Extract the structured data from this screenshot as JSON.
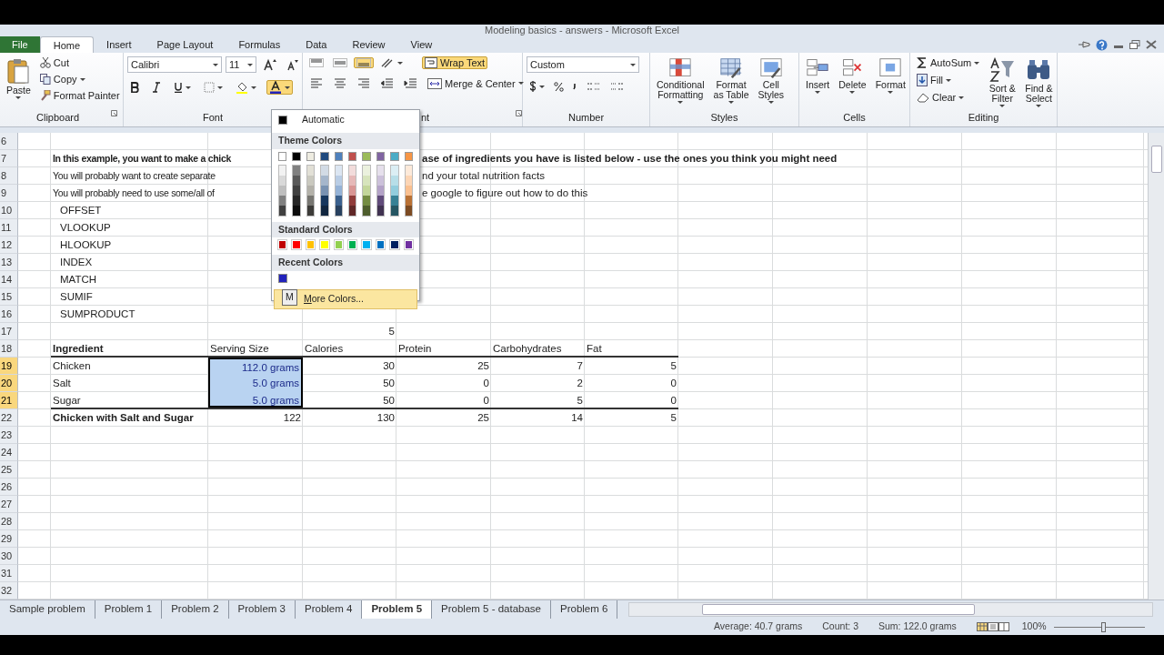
{
  "window": {
    "title": "Modeling basics - answers - Microsoft Excel"
  },
  "ribbon_tabs": [
    {
      "label": "File",
      "kind": "file",
      "selected": false
    },
    {
      "label": "Home",
      "kind": "tab",
      "selected": true
    },
    {
      "label": "Insert",
      "kind": "tab",
      "selected": false
    },
    {
      "label": "Page Layout",
      "kind": "tab",
      "selected": false
    },
    {
      "label": "Formulas",
      "kind": "tab",
      "selected": false
    },
    {
      "label": "Data",
      "kind": "tab",
      "selected": false
    },
    {
      "label": "Review",
      "kind": "tab",
      "selected": false
    },
    {
      "label": "View",
      "kind": "tab",
      "selected": false
    }
  ],
  "clipboard": {
    "label": "Clipboard",
    "paste": "Paste",
    "cut": "Cut",
    "copy": "Copy",
    "format_painter": "Format Painter"
  },
  "font_group": {
    "label": "Font",
    "font_name": "Calibri",
    "font_size": "11",
    "font_color_open": true
  },
  "alignment_group": {
    "label": "nt",
    "wrap_text": {
      "label": "Wrap Text",
      "on": true
    },
    "merge_center": "Merge & Center",
    "vertical_align": [
      {
        "kind": "top",
        "on": false
      },
      {
        "kind": "middle",
        "on": false
      },
      {
        "kind": "bottom",
        "on": true
      }
    ]
  },
  "number_group": {
    "label": "Number",
    "format": "Custom"
  },
  "styles_group": {
    "label": "Styles",
    "buttons": [
      {
        "label": "Conditional\nFormatting",
        "kind": "conditional"
      },
      {
        "label": "Format\nas Table",
        "kind": "table"
      },
      {
        "label": "Cell\nStyles",
        "kind": "styles"
      }
    ]
  },
  "cells_group": {
    "label": "Cells",
    "buttons": [
      {
        "label": "Insert",
        "kind": "insert"
      },
      {
        "label": "Delete",
        "kind": "delete"
      },
      {
        "label": "Format",
        "kind": "format"
      }
    ]
  },
  "editing_group": {
    "label": "Editing",
    "autosum": "AutoSum",
    "fill": "Fill",
    "clear": "Clear",
    "sort_filter": "Sort &\nFilter",
    "find_select": "Find &\nSelect"
  },
  "color_menu": {
    "automatic": "Automatic",
    "theme_heading": "Theme Colors",
    "theme_colors": [
      {
        "color": "#ffffff"
      },
      {
        "color": "#000000"
      },
      {
        "color": "#eeece1"
      },
      {
        "color": "#1f497d"
      },
      {
        "color": "#4f81bd"
      },
      {
        "color": "#c0504d"
      },
      {
        "color": "#9bbb59"
      },
      {
        "color": "#8064a2"
      },
      {
        "color": "#4bacc6"
      },
      {
        "color": "#f79646"
      }
    ],
    "standard_heading": "Standard Colors",
    "standard_colors": [
      {
        "color": "#c00000"
      },
      {
        "color": "#ff0000"
      },
      {
        "color": "#ffc000"
      },
      {
        "color": "#ffff00"
      },
      {
        "color": "#92d050"
      },
      {
        "color": "#00b050"
      },
      {
        "color": "#00b0f0"
      },
      {
        "color": "#0070c0"
      },
      {
        "color": "#002060"
      },
      {
        "color": "#7030a0"
      }
    ],
    "recent_heading": "Recent Colors",
    "recent_colors": [
      {
        "color": "#2222bb"
      }
    ],
    "more_colors": "More Colors...",
    "key_tip": "M"
  },
  "sheet": {
    "rows": [
      {
        "number": "6",
        "selected": false
      },
      {
        "number": "7",
        "selected": false,
        "cells": [
          {
            "text": "In this example, you want to make a chick",
            "kind": "heading",
            "selected": false
          },
          null,
          null,
          null,
          null,
          null
        ],
        "tail": {
          "text": "ase of ingredients you have is listed below - use the ones you think you might need",
          "kind": "heading"
        }
      },
      {
        "number": "8",
        "selected": false,
        "cells": [
          {
            "text": "You will probably want to create separate",
            "kind": "text",
            "selected": false
          },
          null,
          null,
          null,
          null,
          null
        ],
        "tail": {
          "text": "nd your total nutrition facts",
          "kind": "text"
        }
      },
      {
        "number": "9",
        "selected": false,
        "cells": [
          {
            "text": "You will probably need to use some/all of",
            "kind": "text",
            "selected": false
          },
          null,
          null,
          null,
          null,
          null
        ],
        "tail": {
          "text": "e google to figure out how to do this",
          "kind": "text"
        }
      },
      {
        "number": "10",
        "selected": false,
        "cells": [
          {
            "text": "OFFSET",
            "kind": "indented",
            "selected": false
          }
        ]
      },
      {
        "number": "11",
        "selected": false,
        "cells": [
          {
            "text": "VLOOKUP",
            "kind": "indented",
            "selected": false
          }
        ]
      },
      {
        "number": "12",
        "selected": false,
        "cells": [
          {
            "text": "HLOOKUP",
            "kind": "indented",
            "selected": false
          }
        ]
      },
      {
        "number": "13",
        "selected": false,
        "cells": [
          {
            "text": "INDEX",
            "kind": "indented",
            "selected": false
          }
        ]
      },
      {
        "number": "14",
        "selected": false,
        "cells": [
          {
            "text": "MATCH",
            "kind": "indented",
            "selected": false
          }
        ]
      },
      {
        "number": "15",
        "selected": false,
        "cells": [
          {
            "text": "SUMIF",
            "kind": "indented",
            "selected": false
          }
        ]
      },
      {
        "number": "16",
        "selected": false,
        "cells": [
          {
            "text": "SUMPRODUCT",
            "kind": "indented",
            "selected": false
          }
        ]
      },
      {
        "number": "17",
        "selected": false,
        "cells": [
          null,
          null,
          {
            "text": "5",
            "kind": "number",
            "selected": false
          }
        ]
      },
      {
        "number": "18",
        "selected": false,
        "border_bottom": true,
        "cells": [
          {
            "text": "Ingredient",
            "kind": "heading",
            "selected": false
          },
          {
            "text": "Serving Size",
            "kind": "text",
            "selected": false
          },
          {
            "text": "Calories",
            "kind": "text",
            "selected": false
          },
          {
            "text": "Protein",
            "kind": "text",
            "selected": false
          },
          {
            "text": "Carbohydrates",
            "kind": "text",
            "selected": false
          },
          {
            "text": "Fat",
            "kind": "text",
            "selected": false
          }
        ]
      },
      {
        "number": "19",
        "selected": true,
        "cells": [
          {
            "text": "Chicken",
            "kind": "text",
            "selected": false
          },
          {
            "text": "112.0 grams",
            "kind": "input",
            "selected": true
          },
          {
            "text": "30",
            "kind": "number",
            "selected": false
          },
          {
            "text": "25",
            "kind": "number",
            "selected": false
          },
          {
            "text": "7",
            "kind": "number",
            "selected": false
          },
          {
            "text": "5",
            "kind": "number",
            "selected": false
          }
        ]
      },
      {
        "number": "20",
        "selected": true,
        "cells": [
          {
            "text": "Salt",
            "kind": "text",
            "selected": false
          },
          {
            "text": "5.0 grams",
            "kind": "input",
            "selected": true
          },
          {
            "text": "50",
            "kind": "number",
            "selected": false
          },
          {
            "text": "0",
            "kind": "number",
            "selected": false
          },
          {
            "text": "2",
            "kind": "number",
            "selected": false
          },
          {
            "text": "0",
            "kind": "number",
            "selected": false
          }
        ]
      },
      {
        "number": "21",
        "selected": true,
        "border_bottom": true,
        "cells": [
          {
            "text": "Sugar",
            "kind": "text",
            "selected": false
          },
          {
            "text": "5.0 grams",
            "kind": "input",
            "selected": true
          },
          {
            "text": "50",
            "kind": "number",
            "selected": false
          },
          {
            "text": "0",
            "kind": "number",
            "selected": false
          },
          {
            "text": "5",
            "kind": "number",
            "selected": false
          },
          {
            "text": "0",
            "kind": "number",
            "selected": false
          }
        ]
      },
      {
        "number": "22",
        "selected": false,
        "cells": [
          {
            "text": "Chicken with Salt and Sugar",
            "kind": "heading",
            "selected": false
          },
          {
            "text": "122",
            "kind": "number",
            "selected": false
          },
          {
            "text": "130",
            "kind": "number",
            "selected": false
          },
          {
            "text": "25",
            "kind": "number",
            "selected": false
          },
          {
            "text": "14",
            "kind": "number",
            "selected": false
          },
          {
            "text": "5",
            "kind": "number",
            "selected": false
          }
        ]
      },
      {
        "number": "23",
        "selected": false
      },
      {
        "number": "24",
        "selected": false
      },
      {
        "number": "25",
        "selected": false
      },
      {
        "number": "26",
        "selected": false
      },
      {
        "number": "27",
        "selected": false
      },
      {
        "number": "28",
        "selected": false
      },
      {
        "number": "29",
        "selected": false
      },
      {
        "number": "30",
        "selected": false
      },
      {
        "number": "31",
        "selected": false
      },
      {
        "number": "32",
        "selected": false
      }
    ]
  },
  "sheet_tabs": [
    {
      "label": "Sample problem",
      "selected": false
    },
    {
      "label": "Problem 1",
      "selected": false
    },
    {
      "label": "Problem 2",
      "selected": false
    },
    {
      "label": "Problem 3",
      "selected": false
    },
    {
      "label": "Problem 4",
      "selected": false
    },
    {
      "label": "Problem 5",
      "selected": true
    },
    {
      "label": "Problem 5 - database",
      "selected": false
    },
    {
      "label": "Problem 6",
      "selected": false
    }
  ],
  "status_bar": {
    "average": "Average: 40.7 grams",
    "count": "Count: 3",
    "sum": "Sum: 122.0 grams",
    "zoom": {
      "label": "100%",
      "level": 0.55
    }
  }
}
